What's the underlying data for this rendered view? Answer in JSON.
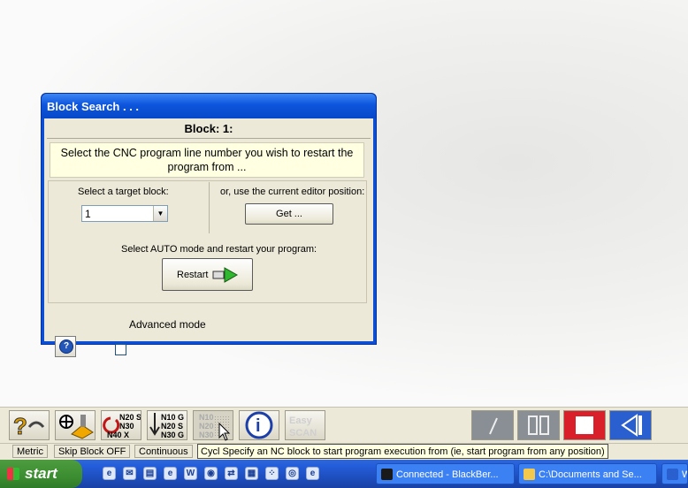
{
  "dialog": {
    "title": "Block Search . . .",
    "header": "Block: 1:",
    "instruction": "Select the CNC program line number you wish to restart the program from ...",
    "target_label": "Select a target block:",
    "target_value": "1",
    "editor_label": "or, use the current editor position:",
    "get_button": "Get ...",
    "auto_label": "Select AUTO mode and restart your program:",
    "restart_button": "Restart",
    "help_icon": "?",
    "advanced_label": "Advanced mode",
    "advanced_checked": false
  },
  "toolbar": {
    "buttons": [
      {
        "icon": "help-arrow-icon",
        "text": ""
      },
      {
        "icon": "tool-probe-icon",
        "text": ""
      },
      {
        "icon": "cycle-icon",
        "text": "N20 S\nN30\nN40 X"
      },
      {
        "icon": "block-down-icon",
        "text": "N10 G\nN20 S\nN30 G"
      },
      {
        "icon": "block-search-icon",
        "text": "N10\nN20\nN30"
      },
      {
        "icon": "info-icon",
        "text": "i"
      },
      {
        "icon": "easy-scan-icon",
        "text": "Easy SCAN"
      }
    ],
    "right_buttons": [
      {
        "icon": "single-step-icon"
      },
      {
        "icon": "pause-icon"
      },
      {
        "icon": "stop-icon"
      },
      {
        "icon": "rewind-icon"
      }
    ],
    "colors": {
      "stop": "#d9202a",
      "rewind": "#2a5fd0"
    }
  },
  "statusbar": {
    "units": "Metric",
    "skip_block": "Skip Block OFF",
    "mode": "Continuous",
    "tooltip": "Cycl Specify an NC block to start program execution from (ie, start program from any position)"
  },
  "taskbar": {
    "start": "start",
    "quicklaunch": [
      "W",
      "e",
      "W",
      "e",
      "e",
      "e",
      "e",
      "e",
      "e",
      "e",
      "e",
      "e",
      "e"
    ],
    "tasks": [
      "Connected - BlackBer...",
      "C:\\Documents and Se...",
      "W"
    ]
  }
}
